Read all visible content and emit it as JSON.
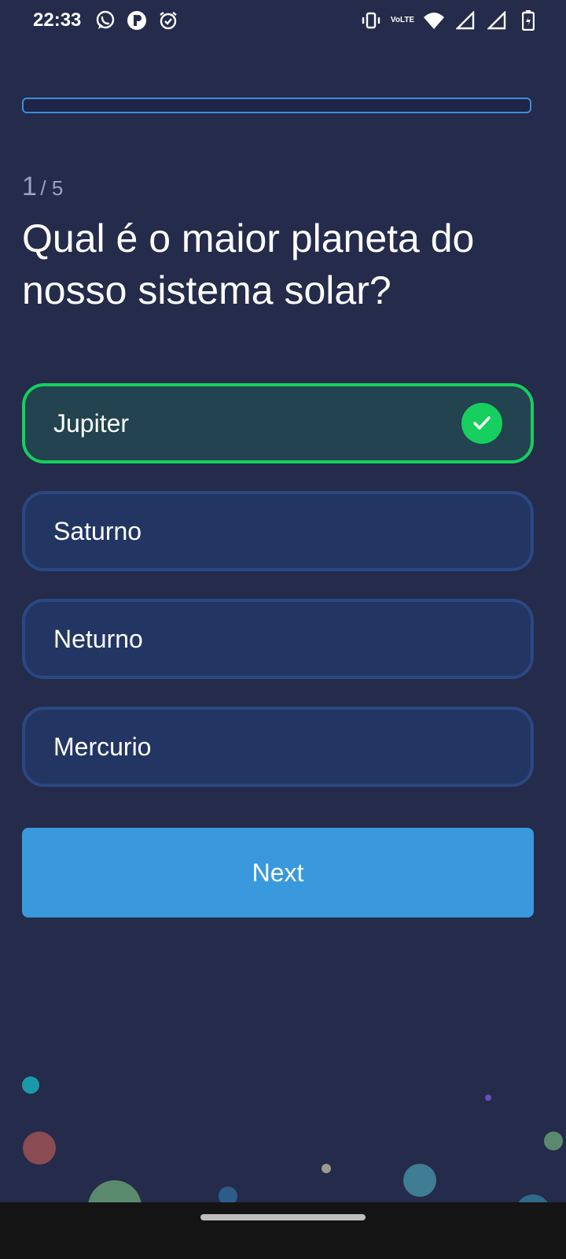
{
  "status_bar": {
    "time": "22:33",
    "left_icons": [
      "whatsapp-icon",
      "app-icon",
      "alarm-icon"
    ],
    "right_icons": [
      "vibrate-icon",
      "volte-icon",
      "wifi-icon",
      "signal-icon",
      "signal-icon",
      "battery-icon"
    ],
    "volte_label_top": "Vo",
    "volte_label_bottom": "LTE"
  },
  "quiz": {
    "progress_fraction": 0,
    "current": "1",
    "total": "/ 5",
    "question": "Qual é o maior planeta do nosso sistema solar?",
    "options": [
      {
        "label": "Jupiter",
        "state": "correct"
      },
      {
        "label": "Saturno",
        "state": "default"
      },
      {
        "label": "Neturno",
        "state": "default"
      },
      {
        "label": "Mercurio",
        "state": "default"
      }
    ],
    "next_label": "Next"
  },
  "colors": {
    "background": "#252b4a",
    "accent": "#3999dc",
    "correct": "#16cf5e",
    "option_fill": "#233663",
    "option_border": "#2b4883"
  }
}
